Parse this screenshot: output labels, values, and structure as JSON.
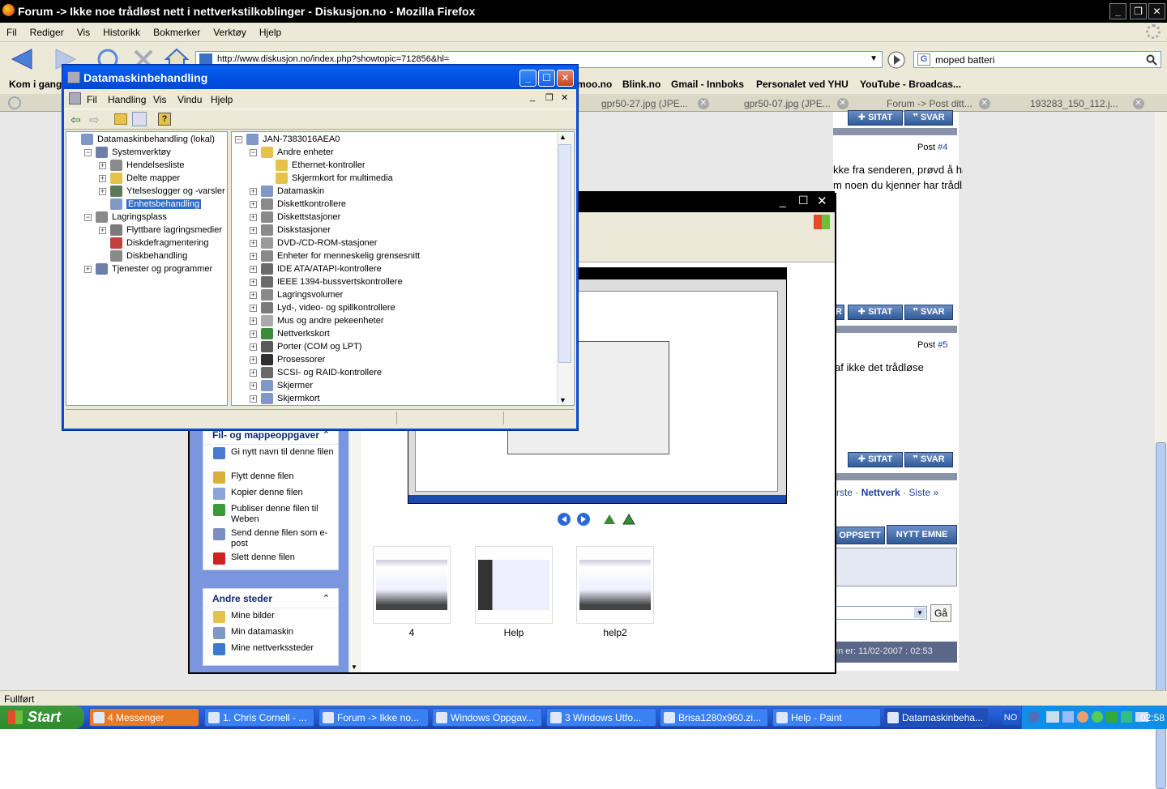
{
  "firefox": {
    "title": "Forum -> Ikke noe trådløst nett i nettverkstilkoblinger - Diskusjon.no - Mozilla Firefox",
    "menu": [
      "Fil",
      "Rediger",
      "Vis",
      "Historikk",
      "Bokmerker",
      "Verktøy",
      "Hjelp"
    ],
    "url": "http://www.diskusjon.no/index.php?showtopic=712856&hl=",
    "search_value": "moped batteri",
    "bookmarks": [
      "Kom i gang",
      "moo.no",
      "Blink.no",
      "Gmail - Innboks",
      "Personalet ved YHU",
      "YouTube - Broadcas..."
    ],
    "tabs": [
      "gpr50-27.jpg (JPE...",
      "gpr50-07.jpg (JPE...",
      "Forum -> Post ditt...",
      "193283_150_112.j..."
    ],
    "status": "Fullført"
  },
  "forum": {
    "post4_label": "Post",
    "post4_num": "#4",
    "post4_text": "kke fra senderen, prøvd å hat maskinen nærmere senderen isofall ? og",
    "post4_text2": "m noen du kjenner har trådløst nettverk på en bærbar maskin eller no,",
    "post5_label": "Post",
    "post5_num": "#5",
    "post5_text": "af ikke det trådløse",
    "sitat": "SITAT",
    "svar": "SVAR",
    "r_btn": "R",
    "nav_prev": "rste",
    "nav_sep": "·",
    "nav_current": "Nettverk",
    "nav_next": "Siste »",
    "oppsett": "OPPSETT",
    "nytt_emne": "NYTT EMNE",
    "go": "Gå",
    "footer": "en er: 11/02-2007 : 02:53"
  },
  "explorer": {
    "file_tasks_title": "Fil- og mappeoppgaver",
    "file_tasks": [
      {
        "label": "Gi nytt navn til denne filen",
        "icon": "rename-icon",
        "color": "#4a7ad0"
      },
      {
        "label": "Flytt denne filen",
        "icon": "move-icon",
        "color": "#d9b13a"
      },
      {
        "label": "Kopier denne filen",
        "icon": "copy-icon",
        "color": "#8aa4d8"
      },
      {
        "label": "Publiser denne filen til Weben",
        "icon": "publish-icon",
        "color": "#3a9a3a"
      },
      {
        "label": "Send denne filen som e-post",
        "icon": "email-icon",
        "color": "#7b8fc2"
      },
      {
        "label": "Slett denne filen",
        "icon": "delete-icon",
        "color": "#d02020"
      }
    ],
    "other_places_title": "Andre steder",
    "other_places": [
      {
        "label": "Mine bilder",
        "icon": "pictures-folder-icon",
        "color": "#e7c24a"
      },
      {
        "label": "Min datamaskin",
        "icon": "my-computer-icon",
        "color": "#7f98c8"
      },
      {
        "label": "Mine nettverkssteder",
        "icon": "network-places-icon",
        "color": "#3a7ad0"
      }
    ],
    "thumbnails": [
      "4",
      "Help",
      "help2"
    ]
  },
  "cm": {
    "title": "Datamaskinbehandling",
    "menu": [
      "Fil",
      "Handling",
      "Vis",
      "Vindu",
      "Hjelp"
    ],
    "left_tree": [
      {
        "label": "Datamaskinbehandling (lokal)",
        "indent": 0,
        "exp": "",
        "color": "#7f98c8"
      },
      {
        "label": "Systemverktøy",
        "indent": 1,
        "exp": "−",
        "color": "#6d7fa8"
      },
      {
        "label": "Hendelsesliste",
        "indent": 2,
        "exp": "+",
        "color": "#8a8a8a"
      },
      {
        "label": "Delte mapper",
        "indent": 2,
        "exp": "+",
        "color": "#e7c24a"
      },
      {
        "label": "Ytelseslogger og -varsler",
        "indent": 2,
        "exp": "+",
        "color": "#5a7a5a"
      },
      {
        "label": "Enhetsbehandling",
        "indent": 2,
        "exp": "",
        "color": "#7f98c8",
        "selected": true
      },
      {
        "label": "Lagringsplass",
        "indent": 1,
        "exp": "−",
        "color": "#8a8a8a"
      },
      {
        "label": "Flyttbare lagringsmedier",
        "indent": 2,
        "exp": "+",
        "color": "#7a7a7a"
      },
      {
        "label": "Diskdefragmentering",
        "indent": 2,
        "exp": "",
        "color": "#c04040"
      },
      {
        "label": "Diskbehandling",
        "indent": 2,
        "exp": "",
        "color": "#8a8a8a"
      },
      {
        "label": "Tjenester og programmer",
        "indent": 1,
        "exp": "+",
        "color": "#6d7fa8"
      }
    ],
    "right_tree": [
      {
        "label": "JAN-7383016AEA0",
        "indent": 0,
        "exp": "−",
        "color": "#7f98c8"
      },
      {
        "label": "Andre enheter",
        "indent": 1,
        "exp": "−",
        "color": "#e7c24a"
      },
      {
        "label": "Ethernet-kontroller",
        "indent": 2,
        "exp": "",
        "color": "#e7c24a"
      },
      {
        "label": "Skjermkort for multimedia",
        "indent": 2,
        "exp": "",
        "color": "#e7c24a"
      },
      {
        "label": "Datamaskin",
        "indent": 1,
        "exp": "+",
        "color": "#7f98c8"
      },
      {
        "label": "Diskettkontrollere",
        "indent": 1,
        "exp": "+",
        "color": "#8a8a8a"
      },
      {
        "label": "Diskettstasjoner",
        "indent": 1,
        "exp": "+",
        "color": "#8a8a8a"
      },
      {
        "label": "Diskstasjoner",
        "indent": 1,
        "exp": "+",
        "color": "#8a8a8a"
      },
      {
        "label": "DVD-/CD-ROM-stasjoner",
        "indent": 1,
        "exp": "+",
        "color": "#9a9a9a"
      },
      {
        "label": "Enheter for menneskelig grensesnitt",
        "indent": 1,
        "exp": "+",
        "color": "#8a8a8a"
      },
      {
        "label": "IDE ATA/ATAPI-kontrollere",
        "indent": 1,
        "exp": "+",
        "color": "#6a6a6a"
      },
      {
        "label": "IEEE 1394-bussvertskontrollere",
        "indent": 1,
        "exp": "+",
        "color": "#6a6a6a"
      },
      {
        "label": "Lagringsvolumer",
        "indent": 1,
        "exp": "+",
        "color": "#8a8a8a"
      },
      {
        "label": "Lyd-, video- og spillkontrollere",
        "indent": 1,
        "exp": "+",
        "color": "#7a7a7a"
      },
      {
        "label": "Mus og andre pekeenheter",
        "indent": 1,
        "exp": "+",
        "color": "#aaaaaa"
      },
      {
        "label": "Nettverkskort",
        "indent": 1,
        "exp": "+",
        "color": "#3a8a3a"
      },
      {
        "label": "Porter (COM og LPT)",
        "indent": 1,
        "exp": "+",
        "color": "#5a5a5a"
      },
      {
        "label": "Prosessorer",
        "indent": 1,
        "exp": "+",
        "color": "#303030"
      },
      {
        "label": "SCSI- og RAID-kontrollere",
        "indent": 1,
        "exp": "+",
        "color": "#6a6a6a"
      },
      {
        "label": "Skjermer",
        "indent": 1,
        "exp": "+",
        "color": "#7f98c8"
      },
      {
        "label": "Skjermkort",
        "indent": 1,
        "exp": "+",
        "color": "#7f98c8"
      }
    ]
  },
  "taskbar": {
    "start": "Start",
    "tasks": [
      {
        "label": "4 Messenger",
        "style": "orange"
      },
      {
        "label": "1. Chris Cornell - ...",
        "style": ""
      },
      {
        "label": "Forum -> Ikke no...",
        "style": ""
      },
      {
        "label": "Windows Oppgav...",
        "style": ""
      },
      {
        "label": "3 Windows Utfo...",
        "style": ""
      },
      {
        "label": "Brisa1280x960.zi...",
        "style": ""
      },
      {
        "label": "Help - Paint",
        "style": ""
      },
      {
        "label": "Datamaskinbeha...",
        "style": "active"
      }
    ],
    "lang": "NO",
    "time": "02:58"
  }
}
